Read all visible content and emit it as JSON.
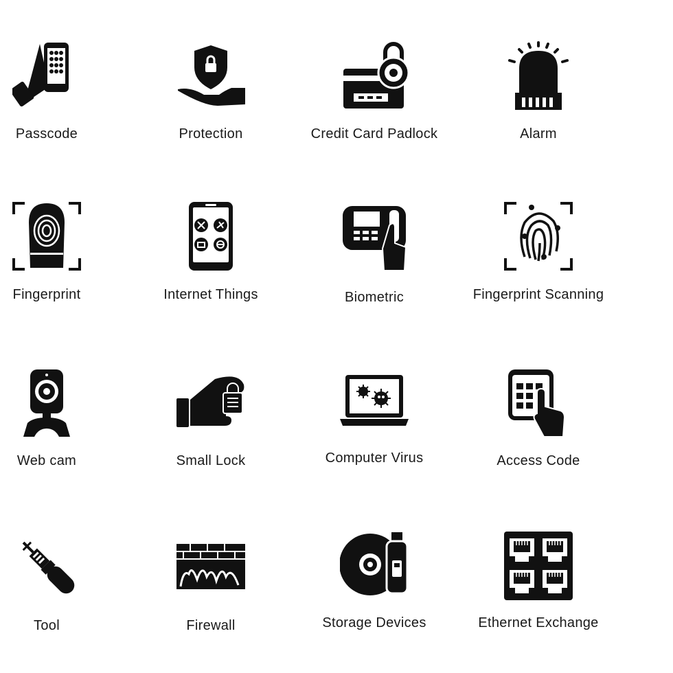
{
  "icons": [
    {
      "label": "Passcode",
      "icon": "hand-phone-keypad-icon"
    },
    {
      "label": "Protection",
      "icon": "shield-hand-icon"
    },
    {
      "label": "Credit Card Padlock",
      "icon": "credit-card-padlock-icon"
    },
    {
      "label": "Alarm",
      "icon": "alarm-siren-icon"
    },
    {
      "label": "Fingerprint",
      "icon": "fingerprint-icon"
    },
    {
      "label": "Internet Things",
      "icon": "smartphone-apps-icon"
    },
    {
      "label": "Biometric",
      "icon": "biometric-device-icon"
    },
    {
      "label": "Fingerprint Scanning",
      "icon": "fingerprint-scan-icon"
    },
    {
      "label": "Web cam",
      "icon": "webcam-icon"
    },
    {
      "label": "Small Lock",
      "icon": "hand-lock-icon"
    },
    {
      "label": "Computer Virus",
      "icon": "laptop-virus-icon"
    },
    {
      "label": "Access Code",
      "icon": "keypad-finger-icon"
    },
    {
      "label": "Tool",
      "icon": "screwdriver-tool-icon"
    },
    {
      "label": "Firewall",
      "icon": "firewall-icon"
    },
    {
      "label": "Storage Devices",
      "icon": "disc-usb-icon"
    },
    {
      "label": "Ethernet Exchange",
      "icon": "ethernet-ports-icon"
    }
  ],
  "colors": {
    "icon": "#111111",
    "background": "#ffffff"
  }
}
